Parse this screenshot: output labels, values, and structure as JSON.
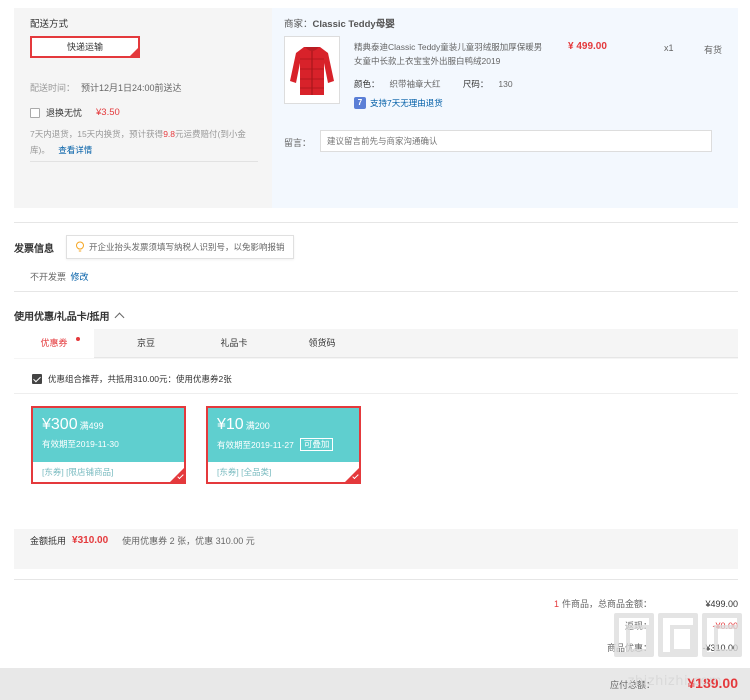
{
  "shipping": {
    "title": "配送方式",
    "method_button": "快递运输",
    "time_label": "配送时间：",
    "time_value": "预计12月1日24:00前送达",
    "insurance_label": "退换无忧",
    "insurance_price": "¥3.50",
    "note_prefix": "7天内退货，15天内换货，预计获得",
    "note_highlight": "9.8",
    "note_suffix": "元运费赔付(到小金库)。",
    "note_link": "查看详情"
  },
  "shop": {
    "merchant_label": "商家：",
    "merchant_name": "Classic Teddy母婴",
    "product_title": "精典泰迪Classic Teddy童装儿童羽绒服加厚保暖男女童中长款上衣宝宝外出服白鸭绒2019",
    "price": "¥ 499.00",
    "qty": "x1",
    "stock": "有货",
    "color_label": "颜色：",
    "color_value": "织带袖章大红",
    "size_label": "尺码：",
    "size_value": "130",
    "return_badge": "7",
    "return_text": "支持7天无理由退货",
    "message_label": "留言：",
    "message_placeholder": "建议留言前先与商家沟通确认",
    "product_color": "#d8222a"
  },
  "invoice": {
    "title": "发票信息",
    "tip": "开企业抬头发票须填写纳税人识别号，以免影响报销",
    "value": "不开发票",
    "edit_link": "修改"
  },
  "coupons": {
    "title": "使用优惠/礼品卡/抵用",
    "tabs": [
      "优惠券",
      "京豆",
      "礼品卡",
      "领货码"
    ],
    "recommend_text": "优惠组合推荐，共抵用310.00元：使用优惠券2张",
    "items": [
      {
        "amount": "¥300",
        "condition": "满499",
        "valid": "有效期至2019-11-30",
        "usable": "",
        "tags": "[东券] [限店铺商品]"
      },
      {
        "amount": "¥10",
        "condition": "满200",
        "valid": "有效期至2019-11-27",
        "usable": "可叠加",
        "tags": "[东券] [全品类]"
      }
    ],
    "total_label": "金额抵用",
    "total_value": "¥310.00",
    "total_desc": "使用优惠券 2 张，优惠 310.00 元",
    "accent_color": "#e4393c",
    "coupon_color": "#5fcfcf"
  },
  "summary": {
    "count": "1",
    "count_label": "件商品，总商品金额：",
    "goods_total": "¥499.00",
    "row2_label": "返现：",
    "row2_value": "-¥0.00",
    "row3_label": "商品优惠：",
    "row3_value": "-¥310.00",
    "pay_label": "应付总额：",
    "pay_value": "¥189.00"
  },
  "watermark": {
    "text": "zhizhizhi.com"
  }
}
